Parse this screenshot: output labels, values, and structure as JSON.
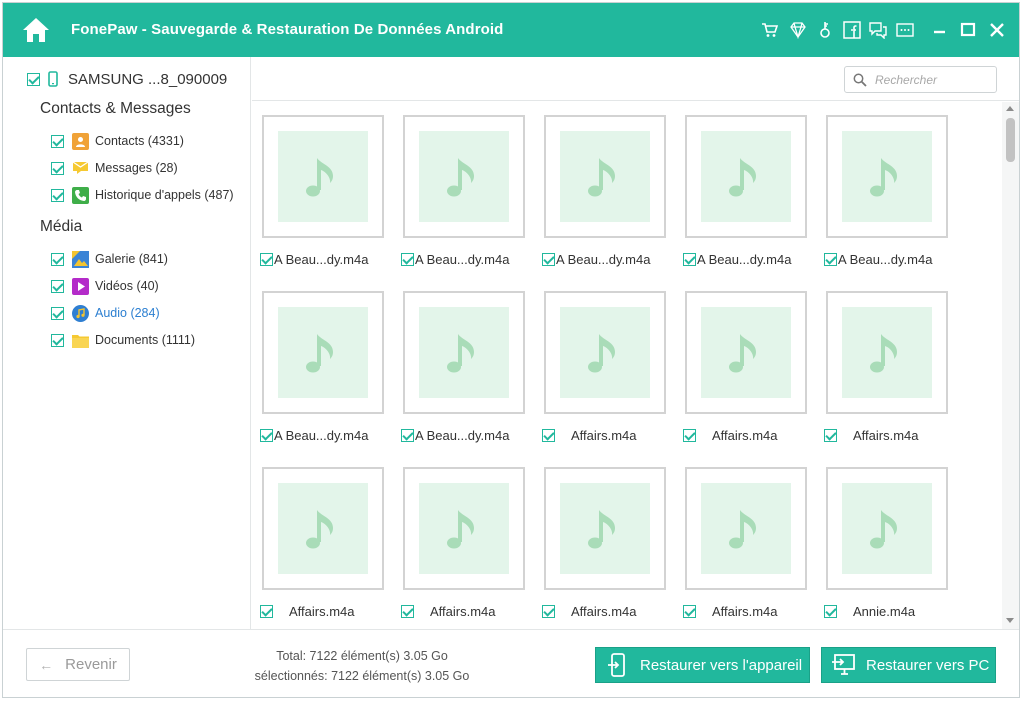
{
  "window": {
    "title": "FonePaw - Sauvegarde & Restauration De Données Android",
    "accent_color": "#21b89d"
  },
  "titlebar_icons": [
    "home-icon",
    "cart-icon",
    "diamond-icon",
    "key-icon",
    "facebook-icon",
    "feedback-icon",
    "menu-icon",
    "minimize-icon",
    "maximize-icon",
    "close-icon"
  ],
  "sidebar": {
    "device_name": "SAMSUNG ...8_090009",
    "sections": [
      {
        "title": "Contacts & Messages",
        "items": [
          {
            "label": "Contacts (4331)",
            "icon": "contacts-icon"
          },
          {
            "label": "Messages (28)",
            "icon": "messages-icon"
          },
          {
            "label": "Historique d'appels (487)",
            "icon": "call-history-icon"
          }
        ]
      },
      {
        "title": "Média",
        "items": [
          {
            "label": "Galerie (841)",
            "icon": "gallery-icon"
          },
          {
            "label": "Vidéos (40)",
            "icon": "videos-icon"
          },
          {
            "label": "Audio (284)",
            "icon": "audio-icon",
            "active": true
          },
          {
            "label": "Documents (1111)",
            "icon": "documents-icon"
          }
        ]
      }
    ]
  },
  "search": {
    "placeholder": "Rechercher"
  },
  "files": [
    "A Beau...dy.m4a",
    "A Beau...dy.m4a",
    "A Beau...dy.m4a",
    "A Beau...dy.m4a",
    "A Beau...dy.m4a",
    "A Beau...dy.m4a",
    "A Beau...dy.m4a",
    "Affairs.m4a",
    "Affairs.m4a",
    "Affairs.m4a",
    "Affairs.m4a",
    "Affairs.m4a",
    "Affairs.m4a",
    "Affairs.m4a",
    "Annie.m4a"
  ],
  "footer": {
    "back_label": "Revenir",
    "total_text": "Total: 7122 élément(s) 3.05 Go",
    "selected_text": "sélectionnés: 7122 élément(s) 3.05 Go",
    "restore_device_label": "Restaurer vers l'appareil",
    "restore_pc_label": "Restaurer vers PC"
  }
}
